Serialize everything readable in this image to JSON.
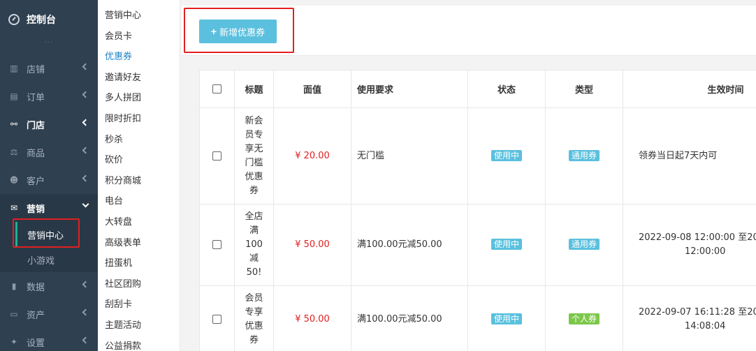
{
  "sidebar": {
    "logo": "控制台",
    "dots": "···",
    "items": [
      {
        "label": "店铺",
        "icon": "shop-icon",
        "glyph": "▥"
      },
      {
        "label": "订单",
        "icon": "order-icon",
        "glyph": "▤"
      },
      {
        "label": "门店",
        "icon": "sitemap-icon",
        "glyph": "⚯"
      },
      {
        "label": "商品",
        "icon": "balance-icon",
        "glyph": "⚖"
      },
      {
        "label": "客户",
        "icon": "users-icon",
        "glyph": "☻"
      },
      {
        "label": "营销",
        "icon": "gift-icon",
        "glyph": "✉"
      }
    ],
    "sub_items": [
      {
        "label": "营销中心"
      },
      {
        "label": "小游戏"
      }
    ],
    "bottom_items": [
      {
        "label": "数据",
        "icon": "bar-chart-icon",
        "glyph": "▮"
      },
      {
        "label": "资产",
        "icon": "money-icon",
        "glyph": "▭"
      },
      {
        "label": "设置",
        "icon": "gear-icon",
        "glyph": "✦"
      }
    ]
  },
  "submenu": {
    "items": [
      "营销中心",
      "会员卡",
      "优惠券",
      "邀请好友",
      "多人拼团",
      "限时折扣",
      "秒杀",
      "砍价",
      "积分商城",
      "电台",
      "大转盘",
      "高级表单",
      "扭蛋机",
      "社区团购",
      "刮刮卡",
      "主题活动",
      "公益捐款"
    ]
  },
  "toolbar": {
    "add_label": "新增优惠券"
  },
  "table": {
    "headers": [
      "标题",
      "面值",
      "使用要求",
      "状态",
      "类型",
      "生效时间"
    ],
    "rows": [
      {
        "title": "新会员专享无门槛优惠券",
        "title_lines": [
          "新会",
          "员专",
          "享无",
          "门槛",
          "优惠",
          "券"
        ],
        "value": "¥ 20.00",
        "requirement": "无门槛",
        "status": "使用中",
        "type": "通用券",
        "time_line1": "领券当日起7天内可",
        "time_line2": ""
      },
      {
        "title": "全店满100减50!",
        "title_lines": [
          "全店",
          "满",
          "100",
          "减",
          "50!"
        ],
        "value": "¥ 50.00",
        "requirement": "满100.00元减50.00",
        "status": "使用中",
        "type": "通用券",
        "time_line1": "2022-09-08 12:00:00 至20",
        "time_line2": "12:00:00"
      },
      {
        "title": "会员专享优惠券",
        "title_lines": [
          "会员",
          "专享",
          "优惠",
          "券"
        ],
        "value": "¥ 50.00",
        "requirement": "满100.00元减50.00",
        "status": "使用中",
        "type": "个人券",
        "time_line1": "2022-09-07 16:11:28 至20",
        "time_line2": "14:08:04"
      }
    ]
  },
  "colors": {
    "sidebar_bg": "#2f4050",
    "accent": "#1ab394",
    "button": "#5bc0de",
    "price": "#e02020",
    "label_info": "#5bc0de",
    "label_success": "#7cc84a",
    "highlight_box": "#e02020"
  }
}
